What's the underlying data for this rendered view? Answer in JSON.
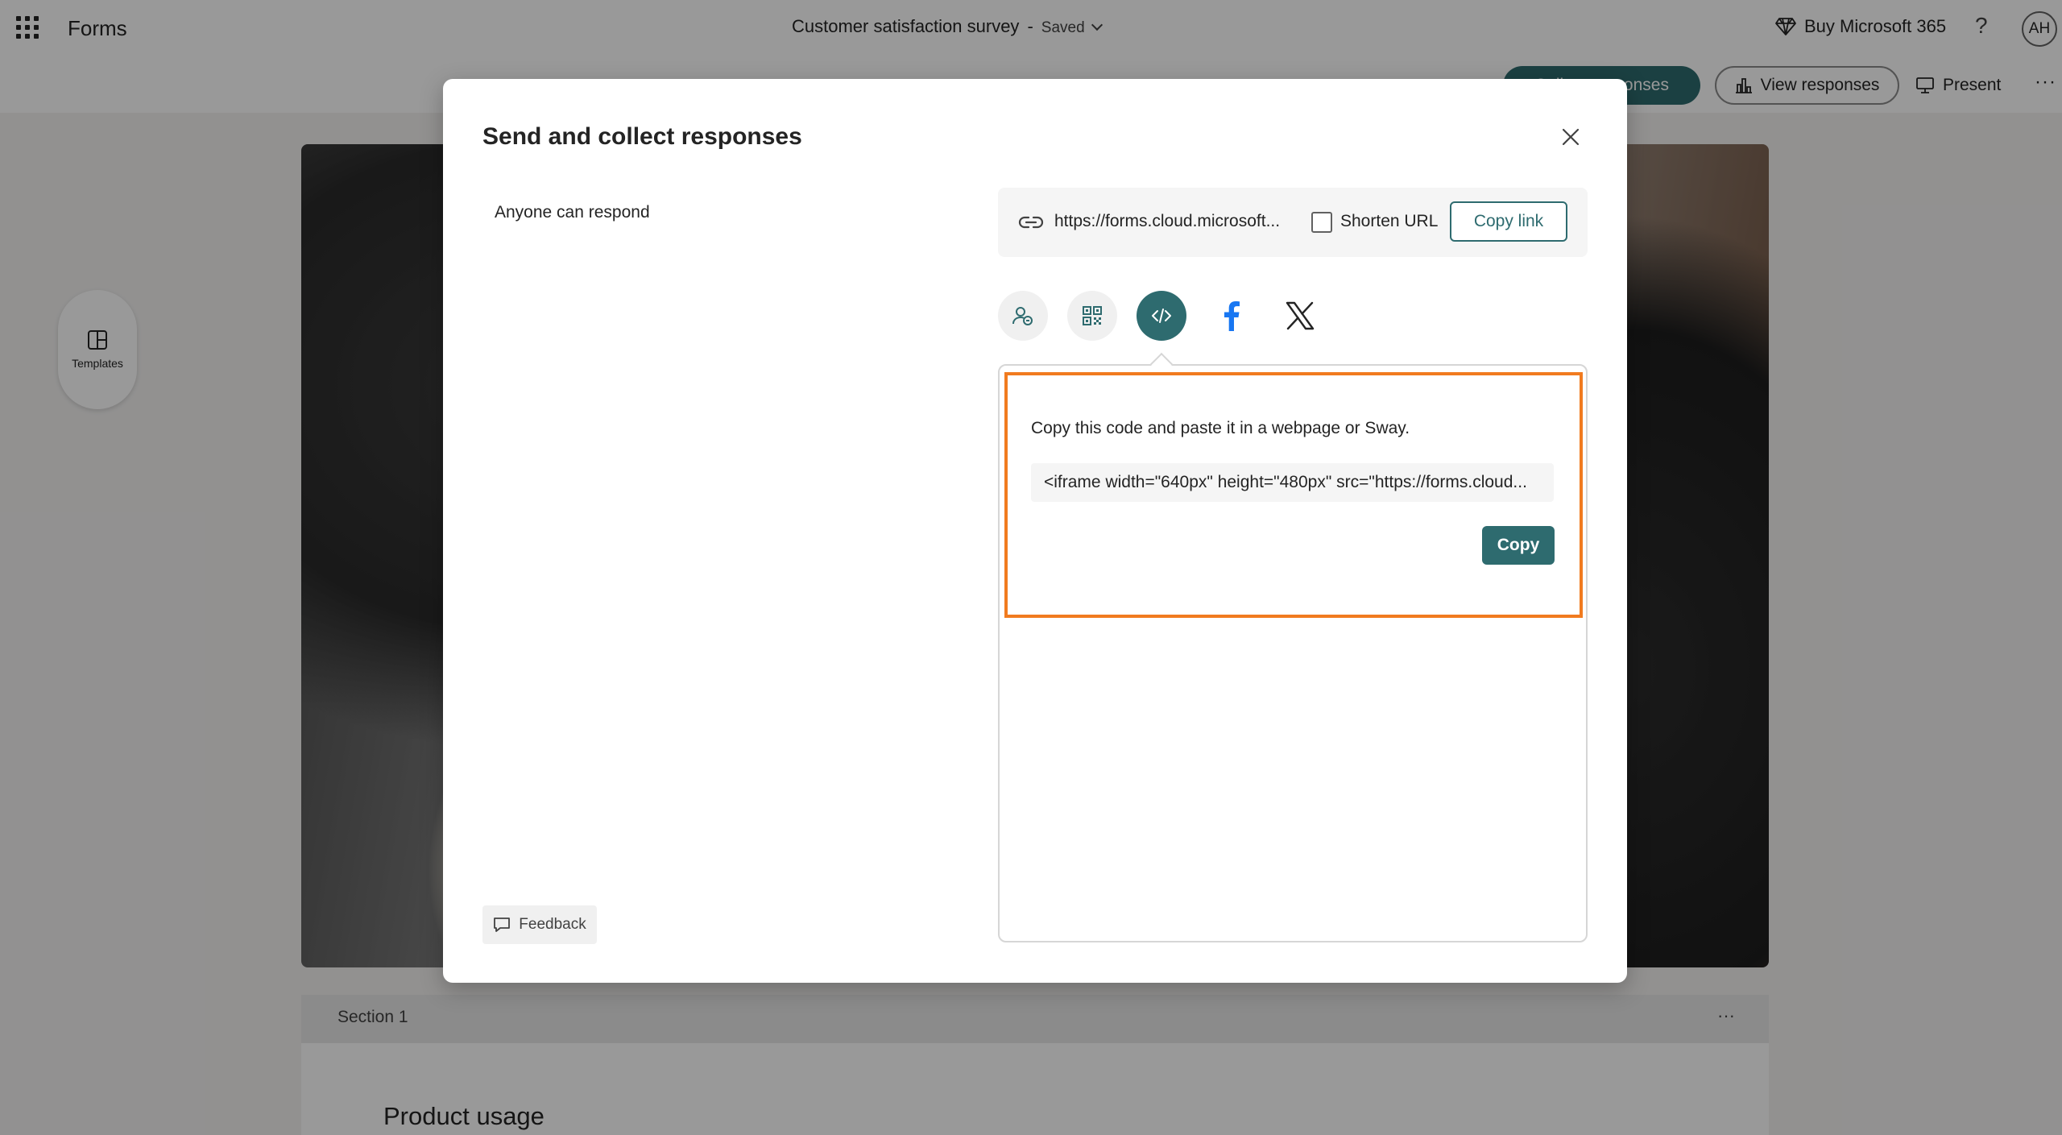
{
  "header": {
    "app_name": "Forms",
    "doc_title": "Customer satisfaction survey",
    "separator": "-",
    "saved_status": "Saved",
    "buy_label": "Buy Microsoft 365",
    "help_glyph": "?",
    "avatar_initials": "AH"
  },
  "toolbar": {
    "collect_label": "Collect responses",
    "view_responses_label": "View responses",
    "present_label": "Present",
    "more_glyph": "···"
  },
  "sidebar": {
    "templates_label": "Templates"
  },
  "form": {
    "section_label": "Section 1",
    "section_more": "···",
    "question_title": "Product usage"
  },
  "dialog": {
    "title": "Send and collect responses",
    "audience_label": "Anyone can respond",
    "link_url": "https://forms.cloud.microsoft...",
    "shorten_url_label": "Shorten URL",
    "shorten_url_checked": false,
    "copy_link_label": "Copy link",
    "share_options": [
      {
        "name": "collect-in-form-icon",
        "selected": false
      },
      {
        "name": "qr-code-icon",
        "selected": false
      },
      {
        "name": "embed-code-icon",
        "selected": true
      },
      {
        "name": "facebook-icon",
        "selected": false
      },
      {
        "name": "x-icon",
        "selected": false
      }
    ],
    "embed_instruction": "Copy this code and paste it in a webpage or Sway.",
    "embed_code": "<iframe width=\"640px\" height=\"480px\" src=\"https://forms.cloud...",
    "copy_label": "Copy",
    "feedback_label": "Feedback"
  },
  "colors": {
    "accent": "#2e6b6f",
    "highlight": "#f17b1f",
    "facebook": "#1877f2"
  }
}
